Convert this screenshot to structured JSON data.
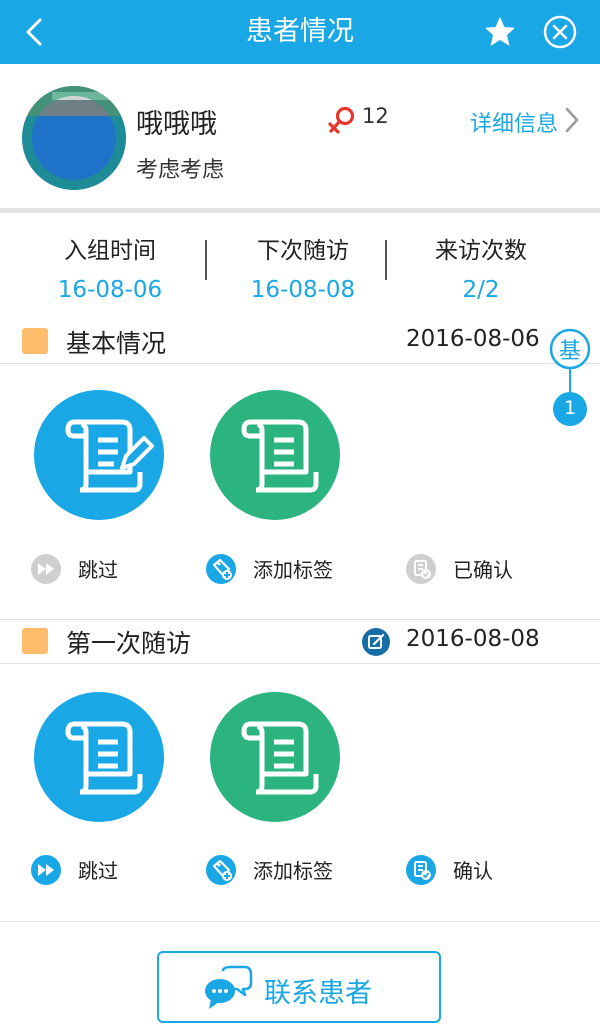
{
  "header": {
    "title": "患者情况",
    "back_icon": "chevron-left-icon",
    "star_icon": "star-icon",
    "close_icon": "close-circle-icon"
  },
  "patient": {
    "name": "哦哦哦",
    "subtitle": "考虑考虑",
    "gender_icon": "female-icon",
    "count": "12",
    "detail_link": "详细信息",
    "detail_chevron": "chevron-right-icon"
  },
  "stats": [
    {
      "label": "入组时间",
      "value": "16-08-06"
    },
    {
      "label": "下次随访",
      "value": "16-08-08"
    },
    {
      "label": "来访次数",
      "value": "2/2"
    }
  ],
  "sections": [
    {
      "title": "基本情况",
      "date": "2016-08-06",
      "actions": [
        {
          "label": "跳过",
          "icon": "fast-forward-icon",
          "state": "disabled"
        },
        {
          "label": "添加标签",
          "icon": "add-tag-icon",
          "state": "active"
        },
        {
          "label": "已确认",
          "icon": "confirm-document-icon",
          "state": "disabled"
        }
      ]
    },
    {
      "title": "第一次随访",
      "date": "2016-08-08",
      "edit_icon": "edit-icon",
      "actions": [
        {
          "label": "跳过",
          "icon": "fast-forward-icon",
          "state": "active"
        },
        {
          "label": "添加标签",
          "icon": "add-tag-icon",
          "state": "active"
        },
        {
          "label": "确认",
          "icon": "confirm-document-icon",
          "state": "active"
        }
      ]
    }
  ],
  "floater": {
    "badge": "基",
    "count": "1"
  },
  "contact_button": {
    "label": "联系患者",
    "icon": "chat-bubbles-icon"
  },
  "colors": {
    "primary": "#1aa7e5",
    "green": "#2bb380",
    "marker": "#ffbd6b",
    "disabled": "#cfcfcf",
    "female": "#e8352e"
  }
}
